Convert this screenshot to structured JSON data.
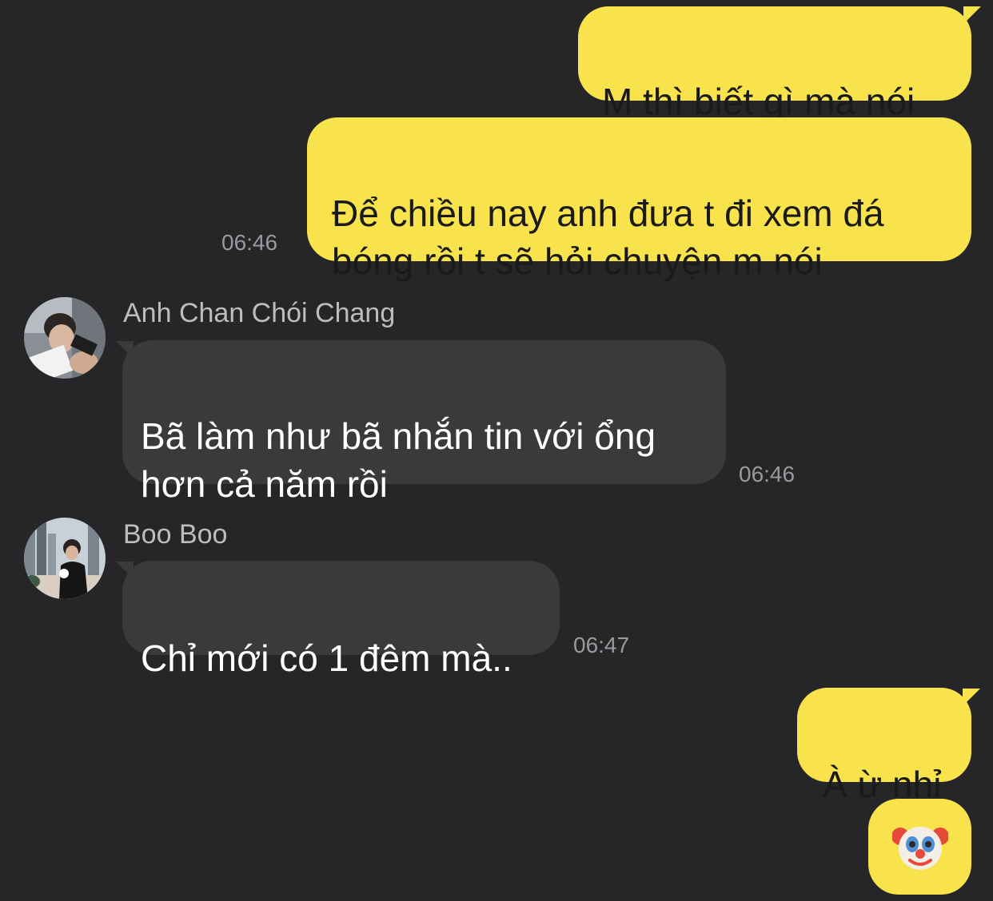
{
  "messages": [
    {
      "id": "m1",
      "side": "out",
      "text": "M thì biết gì mà nói"
    },
    {
      "id": "m2",
      "side": "out",
      "text": "Để chiều nay anh đưa t đi xem đá\nbóng rồi t sẽ hỏi chuyện m nói",
      "time": "06:46"
    },
    {
      "id": "m3",
      "side": "in",
      "sender": "Anh Chan Chói Chang",
      "avatar": "avatar-anh-chan",
      "text": "Bã làm như bã nhắn tin với ổng\nhơn cả năm rồi",
      "time": "06:46"
    },
    {
      "id": "m4",
      "side": "in",
      "sender": "Boo Boo",
      "avatar": "avatar-boo-boo",
      "text": "Chỉ mới có 1 đêm mà..",
      "time": "06:47"
    },
    {
      "id": "m5",
      "side": "out",
      "text": "À ừ nhỉ"
    },
    {
      "id": "m6",
      "side": "out",
      "text": "🤡",
      "icon": "clown-face-emoji"
    }
  ],
  "colors": {
    "background": "#262628",
    "outgoing_bubble": "#f9e34c",
    "incoming_bubble": "#3a3a3c",
    "timestamp": "#9a9a9e",
    "sender_name": "#bdbdbf"
  }
}
